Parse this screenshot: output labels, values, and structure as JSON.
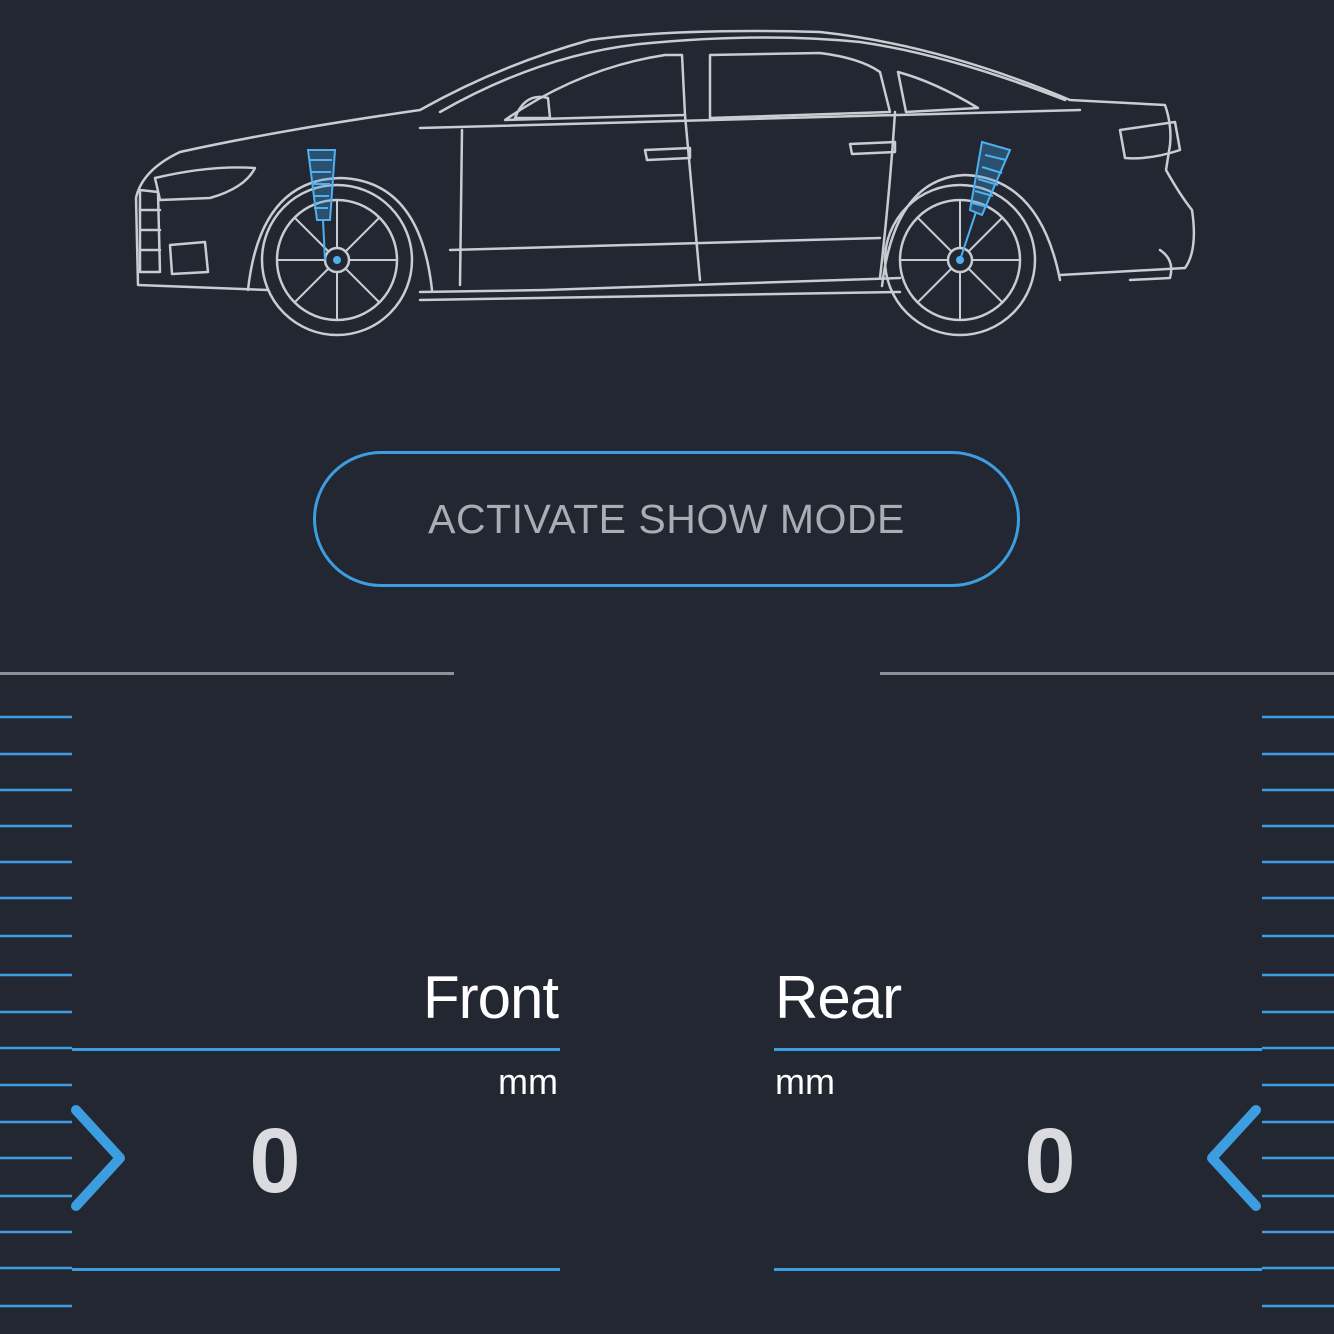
{
  "actions": {
    "show_mode_label": "ACTIVATE SHOW MODE"
  },
  "front": {
    "title": "Front",
    "unit": "mm",
    "value": "0"
  },
  "rear": {
    "title": "Rear",
    "unit": "mm",
    "value": "0"
  },
  "icons": {
    "car": "car-side-outline-icon",
    "front_arrow": "chevron-right-icon",
    "rear_arrow": "chevron-left-icon"
  },
  "colors": {
    "background": "#222732",
    "accent": "#3c9ee0",
    "car_outline": "#c9ccd1",
    "button_text": "#a9adb4",
    "divider": "#8d9198"
  }
}
